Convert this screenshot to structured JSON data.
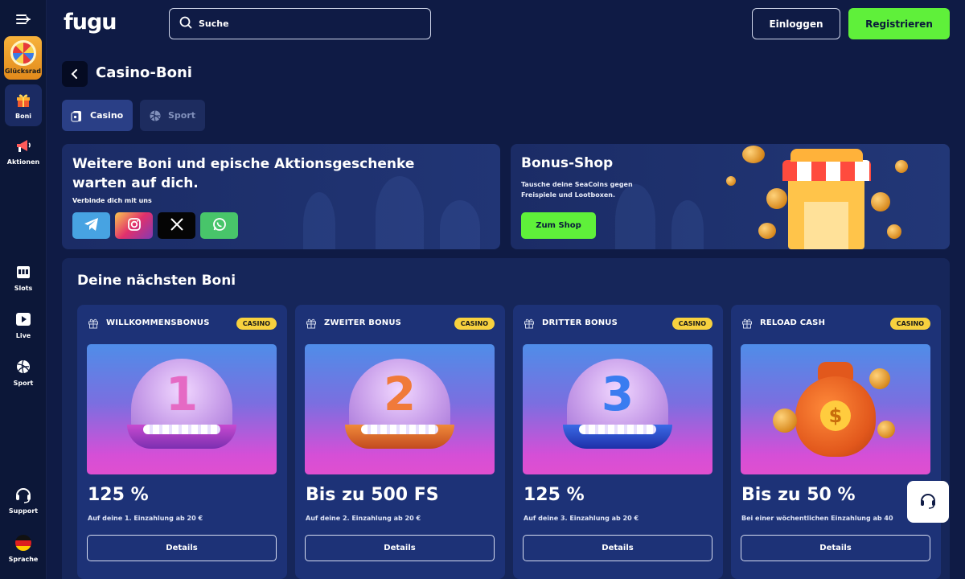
{
  "header": {
    "logo": "fugu",
    "search_placeholder": "Suche",
    "login_label": "Einloggen",
    "register_label": "Registrieren"
  },
  "sidebar": {
    "items": [
      {
        "label": "Glücksrad",
        "icon": "wheel-icon"
      },
      {
        "label": "Boni",
        "icon": "gift-icon"
      },
      {
        "label": "Aktionen",
        "icon": "megaphone-icon"
      },
      {
        "label": "Slots",
        "icon": "slot-machine-icon"
      },
      {
        "label": "Live",
        "icon": "play-icon"
      },
      {
        "label": "Sport",
        "icon": "volleyball-icon"
      },
      {
        "label": "Support",
        "icon": "headset-icon"
      },
      {
        "label": "Sprache",
        "icon": "german-flag-icon"
      }
    ]
  },
  "page": {
    "title": "Casino-Boni"
  },
  "tabs": [
    {
      "label": "Casino",
      "active": true
    },
    {
      "label": "Sport",
      "active": false
    }
  ],
  "banner_social": {
    "title": "Weitere Boni und epische Aktionsgeschenke warten auf dich.",
    "subtitle": "Verbinde dich mit uns",
    "networks": [
      "telegram-icon",
      "instagram-icon",
      "x-icon",
      "whatsapp-icon"
    ]
  },
  "banner_shop": {
    "title": "Bonus-Shop",
    "subtitle": "Tausche deine SeaCoins gegen Freispiele und Lootboxen.",
    "button_label": "Zum Shop"
  },
  "next_bonuses": {
    "title": "Deine nächsten Boni",
    "cards": [
      {
        "name": "WILLKOMMENSBONUS",
        "badge": "CASINO",
        "numeral": "1",
        "amount": "125 %",
        "description": "Auf deine 1. Einzahlung ab 20 €",
        "button": "Details"
      },
      {
        "name": "ZWEITER BONUS",
        "badge": "CASINO",
        "numeral": "2",
        "amount": "Bis zu 500 FS",
        "description": "Auf deine 2. Einzahlung ab 20 €",
        "button": "Details"
      },
      {
        "name": "DRITTER BONUS",
        "badge": "CASINO",
        "numeral": "3",
        "amount": "125 %",
        "description": "Auf deine 3. Einzahlung ab 20 €",
        "button": "Details"
      },
      {
        "name": "RELOAD CASH",
        "badge": "CASINO",
        "numeral": "",
        "amount": "Bis zu 50 %",
        "description": "Bei einer wöchentlichen Einzahlung ab 40",
        "button": "Details"
      }
    ]
  },
  "colors": {
    "background": "#0f1b45",
    "accent_green": "#5ff03a",
    "badge_yellow": "#f7d13e",
    "card": "#1d3277"
  }
}
